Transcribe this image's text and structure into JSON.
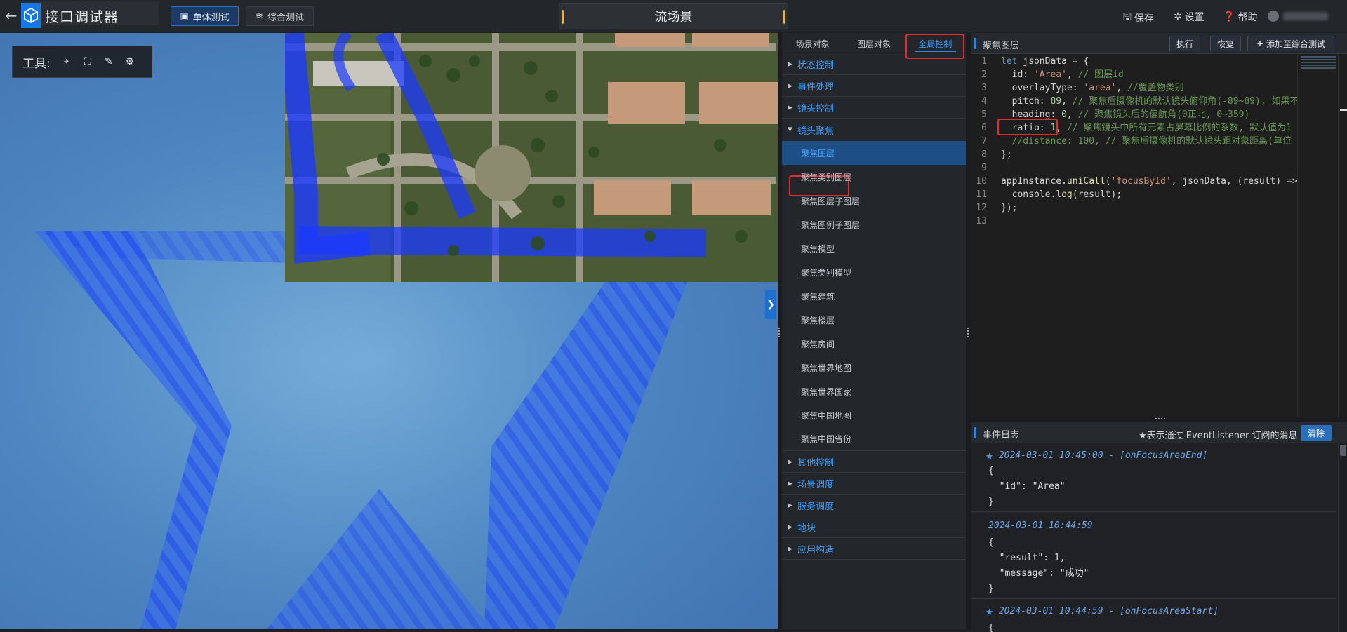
{
  "app": {
    "title": "接口调试器"
  },
  "topbar": {
    "mode_tabs": [
      {
        "label": "单体测试",
        "active": true
      },
      {
        "label": "综合测试",
        "active": false
      }
    ],
    "scene_name": "流场景",
    "actions": [
      {
        "label": "保存",
        "icon": "save-icon"
      },
      {
        "label": "设置",
        "icon": "gear-icon"
      },
      {
        "label": "帮助",
        "icon": "help-icon"
      }
    ]
  },
  "scene": {
    "toolbar_label": "工具:",
    "tools": [
      "locate-icon",
      "frame-select-icon",
      "pen-icon",
      "settings-gears-icon"
    ]
  },
  "api_panel": {
    "tabs": [
      {
        "label": "场景对象",
        "active": false
      },
      {
        "label": "图层对象",
        "active": false
      },
      {
        "label": "全局控制",
        "active": true
      }
    ],
    "groups_top": [
      "状态控制",
      "事件处理",
      "镜头控制"
    ],
    "expanded_group": "镜头聚焦",
    "items": [
      "聚焦图层",
      "聚焦类别图层",
      "聚焦图层子图层",
      "聚焦图例子图层",
      "聚焦模型",
      "聚焦类别模型",
      "聚焦建筑",
      "聚焦楼层",
      "聚焦房间",
      "聚焦世界地图",
      "聚焦世界国家",
      "聚焦中国地图",
      "聚焦中国省份"
    ],
    "selected_item": "聚焦图层",
    "groups_bottom": [
      "其他控制",
      "场景调度",
      "服务调度",
      "地块",
      "应用构造"
    ]
  },
  "editor": {
    "title": "聚焦图层",
    "buttons": {
      "run": "执行",
      "reset": "恢复",
      "add": "添加至综合测试"
    },
    "lines": [
      "let jsonData = {",
      "  id: 'Area', // 图层id",
      "  overlayType: 'area', //覆盖物类别",
      "  pitch: 89, // 聚焦后摄像机的默认镜头俯仰角(-89~89), 如果不",
      "  heading: 0, // 聚焦镜头后的偏航角(0正北, 0~359)",
      "  ratio: 1, // 聚焦镜头中所有元素占屏幕比例的系数, 默认值为1",
      "  //distance: 100, // 聚焦后摄像机的默认镜头距对象距离(单位",
      "};",
      "",
      "appInstance.uniCall('focusById', jsonData, (result) => {",
      "  console.log(result);",
      "});",
      ""
    ]
  },
  "event_log": {
    "title": "事件日志",
    "note": "★表示通过 EventListener 订阅的消息",
    "clear_label": "清除",
    "entries": [
      {
        "header": "2024-03-01 10:45:00 - [onFocusAreaEnd]",
        "starred": true,
        "body": [
          "{",
          "  \"id\": \"Area\"",
          "}"
        ]
      },
      {
        "header": "2024-03-01 10:44:59",
        "starred": false,
        "body": [
          "{",
          "  \"result\": 1,",
          "  \"message\": \"成功\"",
          "}"
        ]
      },
      {
        "header": "2024-03-01 10:44:59 - [onFocusAreaStart]",
        "starred": true,
        "body": [
          "{"
        ]
      }
    ]
  },
  "colors": {
    "accent": "#2b84e6",
    "highlight_box": "#e42a2a",
    "selected_bg": "#1d4f86"
  }
}
